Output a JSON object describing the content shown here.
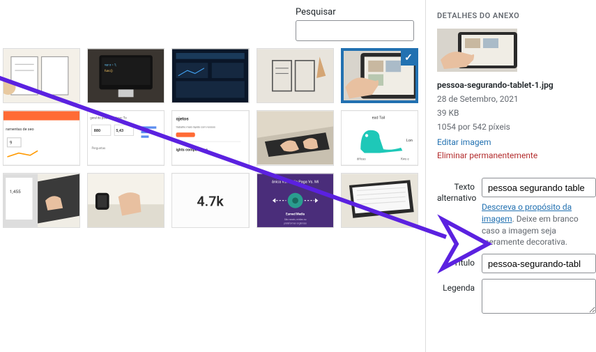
{
  "search": {
    "label": "Pesquisar",
    "value": ""
  },
  "grid": {
    "items": [
      {
        "name": "wireframe-board"
      },
      {
        "name": "imac-code"
      },
      {
        "name": "dashboard-dark"
      },
      {
        "name": "sketch-wireframe"
      },
      {
        "name": "tablet-hand",
        "selected": true
      },
      {
        "name": "seo-tools"
      },
      {
        "name": "keywords-report"
      },
      {
        "name": "projects-panel"
      },
      {
        "name": "laptop-typing"
      },
      {
        "name": "longtail-dino"
      },
      {
        "name": "laptop-hands"
      },
      {
        "name": "smartwatch-keyboard"
      },
      {
        "name": "stat-4-7k"
      },
      {
        "name": "organic-vs-paid"
      },
      {
        "name": "laptop-spreadsheet"
      }
    ],
    "stat_value": "4.7k",
    "media_title": "ânica Vs. Mídia Paga Vs. Mí",
    "media_sub1": "Earned Media",
    "media_sub2": "São canais, mídias ou plataformas orgânicas",
    "longtail_label": "ead Tail",
    "longtail_right": "Lon",
    "longtail_lines": [
      "dificas",
      "Kws e"
    ]
  },
  "attachment": {
    "heading": "DETALHES DO ANEXO",
    "filename": "pessoa-segurando-tablet-1.jpg",
    "date": "28 de Setembro, 2021",
    "filesize": "39 KB",
    "dimensions": "1054 por 542 píxeis",
    "edit_link": "Editar imagem",
    "delete_link": "Eliminar permanentemente"
  },
  "form": {
    "alt_label": "Texto alternativo",
    "alt_value": "pessoa segurando table",
    "alt_help_link": "Descreva o propósito da imagem",
    "alt_help_rest": ". Deixe em branco caso a imagem seja meramente decorativa.",
    "title_label": "Título",
    "title_value": "pessoa-segurando-tabl",
    "caption_label": "Legenda",
    "caption_value": ""
  },
  "colors": {
    "accent": "#2271b1",
    "arrow": "#5b21e0"
  }
}
